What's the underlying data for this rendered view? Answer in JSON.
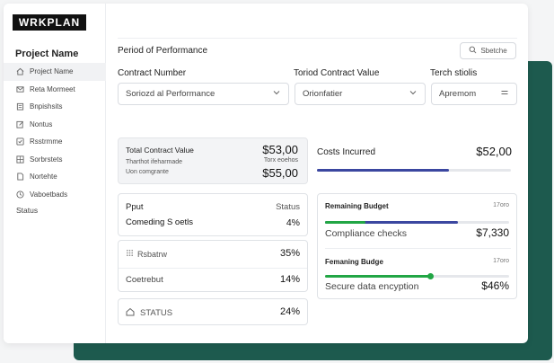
{
  "brand": {
    "logo": "WRKPLAN"
  },
  "colors": {
    "accent_green": "#1d5a4e",
    "bar_navy": "#3b47a0",
    "bar_green": "#22a645",
    "bar_track": "#e5e7eb"
  },
  "sidebar": {
    "title": "Project Name",
    "items": [
      {
        "label": "Project Name",
        "icon": "home-icon",
        "active": true
      },
      {
        "label": "Reta Mormeet",
        "icon": "mail-icon",
        "active": false
      },
      {
        "label": "Bnpishsits",
        "icon": "clipboard-icon",
        "active": false
      },
      {
        "label": "Nontus",
        "icon": "edit-icon",
        "active": false
      },
      {
        "label": "Rsstrmme",
        "icon": "check-square-icon",
        "active": false
      },
      {
        "label": "Sorbrstets",
        "icon": "grid-icon",
        "active": false
      },
      {
        "label": "Nortehte",
        "icon": "file-icon",
        "active": false
      },
      {
        "label": "Vaboetbads",
        "icon": "clock-icon",
        "active": false
      }
    ],
    "status_label": "Status"
  },
  "header": {
    "title": "Period of Performance",
    "search_label": "Sbetche",
    "search_icon": "search-icon"
  },
  "fields": {
    "contract_number": {
      "label": "Contract Number",
      "value": "Soriozd al Performance",
      "icon": "chevron-down-icon"
    },
    "contract_value": {
      "label": "Toriod Contract Value",
      "value": "Orionfatier",
      "icon": "chevron-down-icon"
    },
    "third": {
      "label": "Terch stiolis",
      "value": "Apremom",
      "icon": "menu-icon"
    }
  },
  "total_contract": {
    "label": "Total Contract Value",
    "sub1": "Tharthot ifeharmade",
    "sub2": "Uon comgrante",
    "value1": "$53,00",
    "value_sub": "Torx eoehos",
    "value2": "$55,00"
  },
  "costs": {
    "label": "Costs Incurred",
    "value": "$52,00",
    "progress": 0.68
  },
  "pput": {
    "label": "Pput",
    "status_label": "Status",
    "item": "Comeding S oetls",
    "percent": "4%"
  },
  "metrics": {
    "row1_label": "Rsbatrw",
    "row1_icon": "grid-dots-icon",
    "row1_value": "35%",
    "row2_label": "Coetrebut",
    "row2_value": "14%"
  },
  "status_box": {
    "label": "STATUS",
    "icon": "house-icon",
    "value": "24%"
  },
  "budget": {
    "block1": {
      "title": "Remaining Budget",
      "note": "17oro",
      "item": "Compliance checks",
      "value": "$7,330",
      "green_progress": 0.22,
      "navy_progress": 0.72
    },
    "block2": {
      "title": "Femaning Budge",
      "note": "17oro",
      "item": "Secure data encyption",
      "value": "$46%",
      "progress": 0.57
    }
  }
}
